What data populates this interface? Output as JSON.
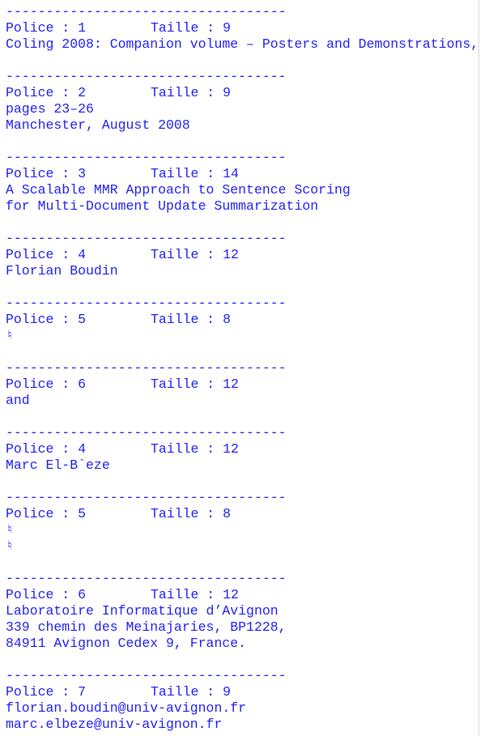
{
  "separator": "-----------------------------------",
  "colors": {
    "text": "#1d1df0",
    "background": "#ffffff"
  },
  "blocks": [
    {
      "police": "Police : 1",
      "taille": "Taille : 9",
      "lines": [
        "Coling 2008: Companion volume – Posters and Demonstrations, "
      ]
    },
    {
      "police": "Police : 2",
      "taille": "Taille : 9",
      "lines": [
        "pages 23–26",
        "Manchester, August 2008"
      ]
    },
    {
      "police": "Police : 3",
      "taille": "Taille : 14",
      "lines": [
        "A Scalable MMR Approach to Sentence Scoring",
        "for Multi-Document Update Summarization"
      ]
    },
    {
      "police": "Police : 4",
      "taille": "Taille : 12",
      "lines": [
        "Florian Boudin"
      ]
    },
    {
      "police": "Police : 5",
      "taille": "Taille : 8",
      "lines": [
        "♮"
      ]
    },
    {
      "police": "Police : 6",
      "taille": "Taille : 12",
      "lines": [
        "and"
      ]
    },
    {
      "police": "Police : 4",
      "taille": "Taille : 12",
      "lines": [
        "Marc El-B`eze"
      ]
    },
    {
      "police": "Police : 5",
      "taille": "Taille : 8",
      "lines": [
        "♮",
        "♮"
      ]
    },
    {
      "police": "Police : 6",
      "taille": "Taille : 12",
      "lines": [
        "Laboratoire Informatique d’Avignon",
        "339 chemin des Meinajaries, BP1228,",
        "84911 Avignon Cedex 9, France."
      ]
    },
    {
      "police": "Police : 7",
      "taille": "Taille : 9",
      "lines": [
        "florian.boudin@univ-avignon.fr",
        "marc.elbeze@univ-avignon.fr"
      ]
    }
  ]
}
